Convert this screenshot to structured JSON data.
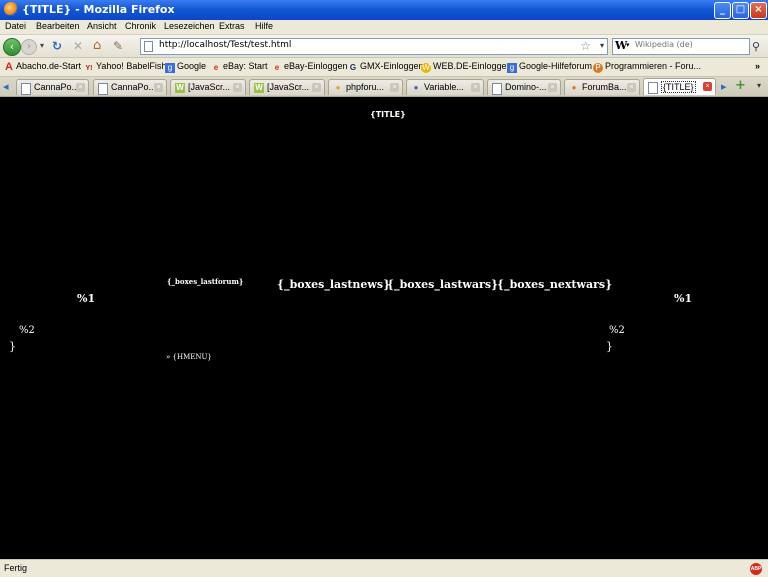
{
  "window": {
    "title": "{TITLE} - Mozilla Firefox",
    "buttons": {
      "minimize": "_",
      "maximize": "□",
      "close": "×"
    }
  },
  "menu": [
    "Datei",
    "Bearbeiten",
    "Ansicht",
    "Chronik",
    "Lesezeichen",
    "Extras",
    "Hilfe"
  ],
  "nav": {
    "back": "‹",
    "forward": "›",
    "reload": "↻",
    "stop": "✕",
    "home": "⌂",
    "url": "http://localhost/Test/test.html",
    "search_engine": "W",
    "search_placeholder": "Wikipedia (de)"
  },
  "bookmarks": [
    {
      "label": "Abacho.de-Start",
      "icon": "A",
      "color": "#d8281a"
    },
    {
      "label": "Yahoo! BabelFish",
      "icon": "Y!",
      "color": "#b3121a"
    },
    {
      "label": "Google",
      "icon": "g",
      "color": "#3a6fd8"
    },
    {
      "label": "eBay: Start",
      "icon": "e",
      "color": "#d22b1f"
    },
    {
      "label": "eBay-Einloggen",
      "icon": "e",
      "color": "#d22b1f"
    },
    {
      "label": "GMX-Einloggen",
      "icon": "G",
      "color": "#1c2f6b"
    },
    {
      "label": "WEB.DE-Einloggen",
      "icon": "W",
      "color": "#e6b900"
    },
    {
      "label": "Google-Hilfeforum",
      "icon": "g",
      "color": "#3a6fd8"
    },
    {
      "label": "Programmieren - Foru...",
      "icon": "P",
      "color": "#d67b2a"
    }
  ],
  "tabs": [
    {
      "label": "CannaPo...",
      "icon": "▯",
      "active": false
    },
    {
      "label": "CannaPo...",
      "icon": "▯",
      "active": false
    },
    {
      "label": "[JavaScr...",
      "icon": "W",
      "active": false
    },
    {
      "label": "[JavaScr...",
      "icon": "W",
      "active": false
    },
    {
      "label": "phpforu...",
      "icon": "●",
      "active": false
    },
    {
      "label": "Variable...",
      "icon": "●",
      "active": false
    },
    {
      "label": "Domino-...",
      "icon": "▯",
      "active": false
    },
    {
      "label": "ForumBa...",
      "icon": "●",
      "active": false
    },
    {
      "label": "{TITLE}",
      "icon": "▯",
      "active": true
    }
  ],
  "content": {
    "title": "{TITLE}",
    "box_lastforum": "{_boxes_lastforum}",
    "box_lastnews": "{_boxes_lastnews}",
    "box_lastwars": "{_boxes_lastwars}",
    "box_nextwars": "{_boxes_nextwars}",
    "left_p1": "%1",
    "right_p1": "%1",
    "left_p2": "%2",
    "right_p2": "%2",
    "left_brace": "}",
    "right_brace": "}",
    "hmenu": "» {HMENU}"
  },
  "status": {
    "text": "Fertig",
    "adblock": "ABP"
  }
}
